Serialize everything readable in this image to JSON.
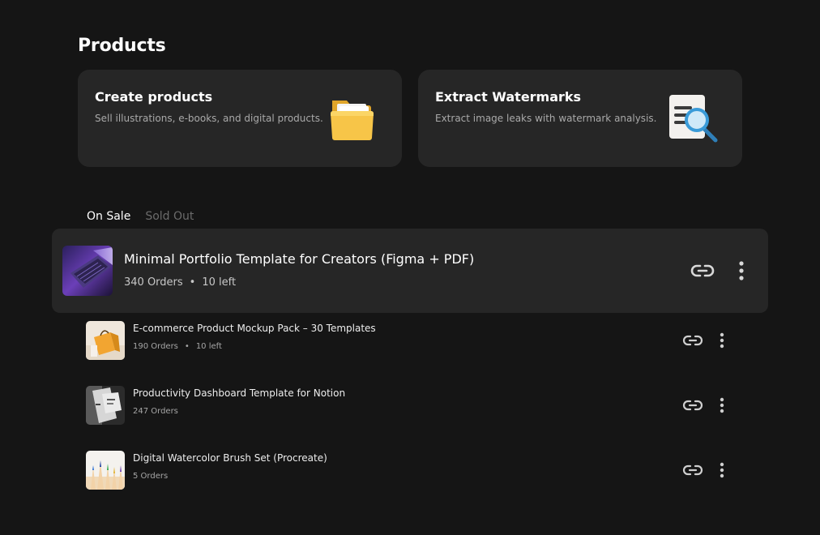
{
  "page": {
    "title": "Products"
  },
  "cards": [
    {
      "title": "Create products",
      "description": "Sell illustrations, e-books, and digital products.",
      "icon": "folder-icon"
    },
    {
      "title": "Extract Watermarks",
      "description": "Extract image leaks with watermark analysis.",
      "icon": "document-search-icon"
    }
  ],
  "tabs": [
    {
      "label": "On Sale",
      "active": true
    },
    {
      "label": "Sold Out",
      "active": false
    }
  ],
  "products": [
    {
      "title": "Minimal Portfolio Template for Creators (Figma + PDF)",
      "orders": "340 Orders",
      "separator": "•",
      "stock": "10 left",
      "thumbnail": "laptop-thumbnail"
    },
    {
      "title": "E-commerce Product Mockup Pack – 30 Templates",
      "orders": "190 Orders",
      "separator": "•",
      "stock": "10 left",
      "thumbnail": "shopping-bag-thumbnail"
    },
    {
      "title": "Productivity Dashboard Template for Notion",
      "orders": "247 Orders",
      "thumbnail": "business-card-thumbnail"
    },
    {
      "title": "Digital Watercolor Brush Set (Procreate)",
      "orders": "5 Orders",
      "thumbnail": "colored-pencils-thumbnail"
    }
  ],
  "colors": {
    "background": "#151515",
    "card": "#262626",
    "text_primary": "#ffffff",
    "text_secondary": "#a9a9a9",
    "tab_inactive": "#6b6b6b",
    "folder": "#f6c244",
    "magnifier": "#3a9bd8"
  }
}
